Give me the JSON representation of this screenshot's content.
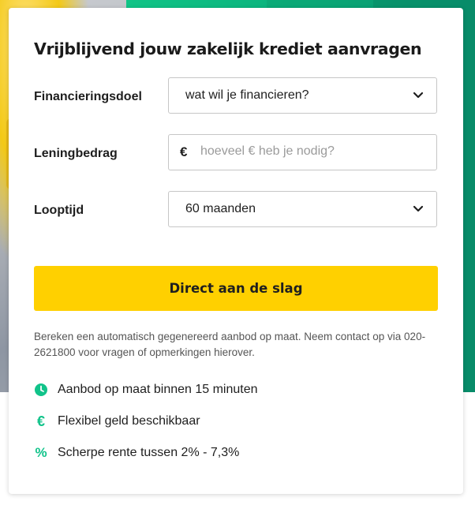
{
  "form": {
    "title": "Vrijblijvend jouw zakelijk krediet aanvragen",
    "fields": {
      "purpose": {
        "label": "Financieringsdoel",
        "value": "wat wil je financieren?"
      },
      "amount": {
        "label": "Leningbedrag",
        "prefix": "€",
        "placeholder": "hoeveel € heb je nodig?"
      },
      "term": {
        "label": "Looptijd",
        "value": "60 maanden"
      }
    },
    "submit_label": "Direct aan de slag",
    "info_text": "Bereken een automatisch gegenereerd aanbod op maat. Neem contact op via 020-2621800 voor vragen of opmerkingen hierover."
  },
  "features": [
    {
      "icon": "clock-icon",
      "text": "Aanbod op maat binnen 15 minuten"
    },
    {
      "icon": "euro-icon",
      "text": "Flexibel geld beschikbaar"
    },
    {
      "icon": "percent-icon",
      "text": "Scherpe rente tussen 2% - 7,3%"
    }
  ],
  "colors": {
    "accent_yellow": "#ffd000",
    "brand_green": "#11c38a",
    "text": "#1e1e1e"
  }
}
